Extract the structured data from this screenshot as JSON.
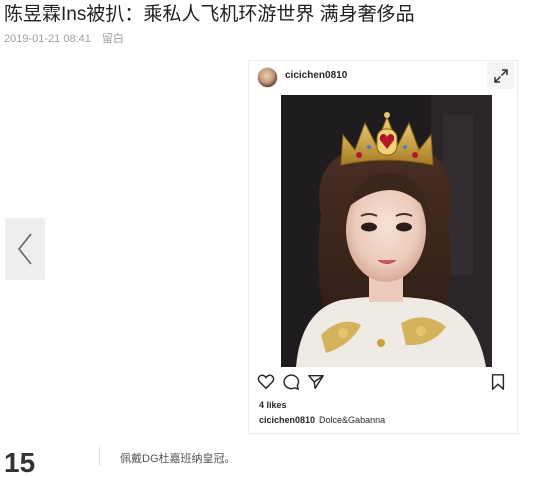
{
  "article": {
    "title": "陈昱霖Ins被扒：乘私人飞机环游世界 满身奢侈品",
    "date": "2019-01-21 08:41",
    "comment_label": "留白"
  },
  "gallery": {
    "prev_icon": "chevron-left-icon",
    "page_number": "15",
    "caption": "佩戴DG杜嘉班纳皇冠。"
  },
  "instagram_post": {
    "username": "cicichen0810",
    "likes": "4 likes",
    "caption_user": "cicichen0810",
    "caption_text": "Dolce&Gabanna",
    "icons": [
      "heart-icon",
      "comment-icon",
      "share-icon",
      "bookmark-icon",
      "expand-icon"
    ]
  },
  "colors": {
    "title": "#222222",
    "meta": "#a0a0a0",
    "crown_gold": "#c9a33a",
    "crown_red": "#b0182a"
  }
}
